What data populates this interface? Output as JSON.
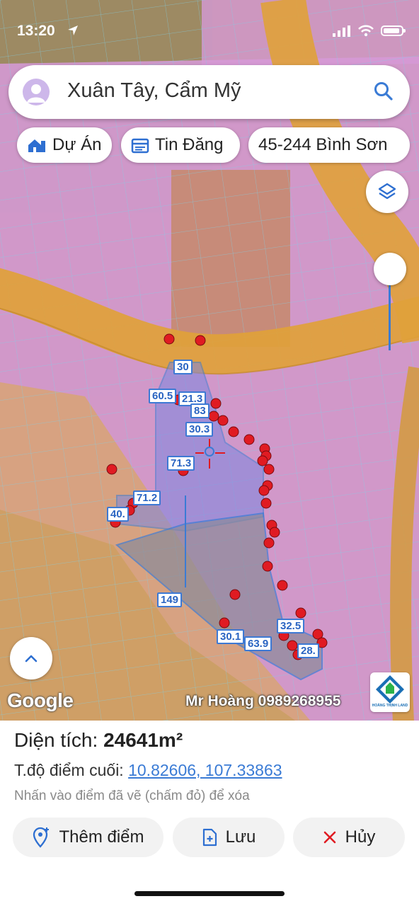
{
  "status": {
    "time": "13:20"
  },
  "search": {
    "text": "Xuân Tây, Cẩm Mỹ"
  },
  "chips": [
    {
      "label": "Dự Án",
      "icon": "home-city-icon"
    },
    {
      "label": "Tin Đăng",
      "icon": "calendar-icon"
    },
    {
      "label": "45-244 Bình Sơn"
    }
  ],
  "map": {
    "google_logo": "Google",
    "watermark": "Mr Hoàng 0989268955",
    "brand_logo_text": "HOÀNG THỊNH LAND",
    "measurements": [
      "30",
      "60.5",
      "21.3",
      "83",
      "30.3",
      "71.3",
      "71.2",
      "40.",
      "149",
      "30.1",
      "63.9",
      "32.5",
      "28."
    ]
  },
  "panel": {
    "area_label": "Diện tích: ",
    "area_value": "24641m²",
    "coord_label": "T.độ điểm cuối: ",
    "coord_value": "10.82606, 107.33863",
    "hint": "Nhấn vào điểm đã vẽ (chấm đỏ) để xóa"
  },
  "actions": {
    "add": "Thêm điểm",
    "save": "Lưu",
    "cancel": "Hủy"
  },
  "colors": {
    "accent": "#3a7bd5",
    "pin": "#e01b22",
    "zone_residential": "#d79bd6",
    "zone_road": "#e8a23a"
  }
}
